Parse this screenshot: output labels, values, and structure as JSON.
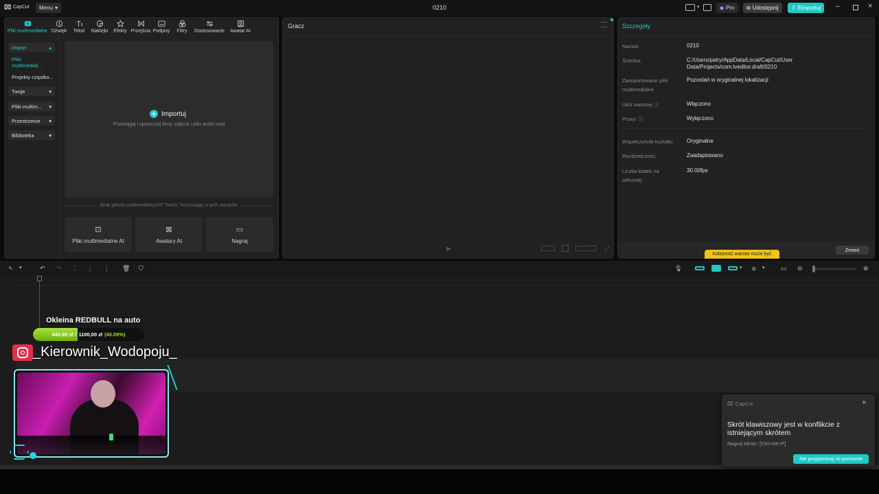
{
  "app": {
    "logo_text": "CapCut",
    "menu_label": "Menu",
    "project_title": "0210",
    "pro_label": "Pro",
    "share_label": "Udostępnij",
    "export_label": "Eksportuj"
  },
  "toolbar": {
    "tabs": [
      {
        "label": "Pliki multimedialne",
        "icon": "media-icon"
      },
      {
        "label": "Dźwięk",
        "icon": "audio-icon"
      },
      {
        "label": "Tekst",
        "icon": "text-icon"
      },
      {
        "label": "Naklejki",
        "icon": "sticker-icon"
      },
      {
        "label": "Efekty",
        "icon": "effects-icon"
      },
      {
        "label": "Przejścia",
        "icon": "transitions-icon"
      },
      {
        "label": "Podpisy",
        "icon": "captions-icon"
      },
      {
        "label": "Filtry",
        "icon": "filters-icon"
      },
      {
        "label": "Dostosowanie",
        "icon": "adjust-icon"
      },
      {
        "label": "Awatar AI",
        "icon": "avatar-icon"
      }
    ]
  },
  "sidebar": {
    "items": [
      {
        "label": "Import",
        "caret": "▴"
      },
      {
        "label": "Pliki multimedial...",
        "caret": ""
      },
      {
        "label": "Projekty cząstko...",
        "caret": ""
      },
      {
        "label": "Twoje",
        "caret": "▾"
      },
      {
        "label": "Pliki multim...",
        "caret": "▾"
      },
      {
        "label": "Przestrzenie",
        "caret": "▾"
      },
      {
        "label": "Biblioteka",
        "caret": "▾"
      }
    ]
  },
  "media": {
    "import_label": "Importuj",
    "drop_hint": "Przeciągaj i upuszczaj filmy, zdjęcia i pliki audio tutaj",
    "empty_hint": "Brak plików multimedialnych? Twórz, korzystając z tych narzędzi",
    "cards": [
      {
        "label": "Pliki multimedialne AI"
      },
      {
        "label": "Awatary AI"
      },
      {
        "label": "Nagraj"
      }
    ]
  },
  "player": {
    "title": "Gracz"
  },
  "details": {
    "title": "Szczegóły",
    "rows": [
      {
        "label": "Nazwa:",
        "value": "0210"
      },
      {
        "label": "Ścieżka:",
        "value": "C:/Users/patry/AppData/Local/CapCut/User Data/Projects/com.lveditor.draft/0210"
      },
      {
        "label": "Zaimportowane pliki multimedialne",
        "value": "Pozostań w oryginalnej lokalizacji"
      },
      {
        "label": "Ułóż warstwy ⓘ",
        "value": "Włączono"
      },
      {
        "label": "Proxy: ⓘ",
        "value": "Wyłączono"
      },
      {
        "label": "Współczynnik kształtu:",
        "value": "Oryginalne"
      },
      {
        "label": "Rozdzielczość:",
        "value": "Zaadaptowano"
      },
      {
        "label": "Liczba klatek na sekundę:",
        "value": "30.00fps"
      }
    ],
    "change_label": "Zmień",
    "tooltip": "Kolejność warstw może być"
  },
  "overlay": {
    "goal_title": "Okleina REDBULL na auto",
    "goal_text_current": "440,99 zł",
    "goal_text_target": "1100,00 zł",
    "goal_text_percent": "(40.09%)",
    "goal_progress": 0.4009,
    "handle": "_Kierownik_Wodopoju_",
    "accent": "#22d3e6",
    "goal_color": "#8fd11f"
  },
  "toast": {
    "brand": "CapCut",
    "title": "Skrót klawiszowy jest w konflikcie z istniejącym skrótem",
    "subtitle": "Nagraj ekran: [Ctrl+Alt+P]",
    "button": "Nie przypominaj mi ponownie"
  },
  "colors": {
    "accent": "#1fc9c5",
    "background": "#0b0b0b",
    "panel": "#212121"
  }
}
